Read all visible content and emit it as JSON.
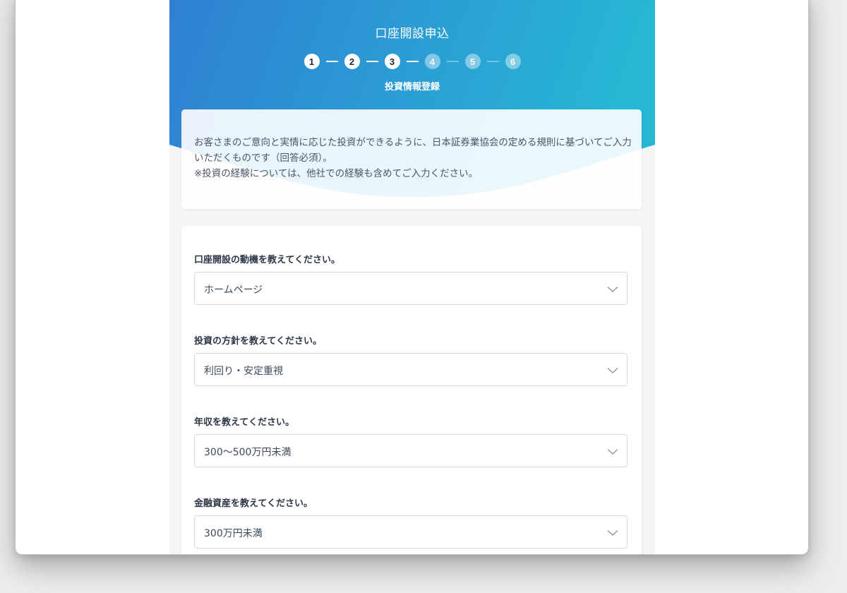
{
  "header": {
    "title": "口座開設申込",
    "steps": [
      "1",
      "2",
      "3",
      "4",
      "5",
      "6"
    ],
    "current_step": 3,
    "step_caption": "投資情報登録"
  },
  "notice": {
    "text": "お客さまのご意向と実情に応じた投資ができるように、日本証券業協会の定める規則に基づいてご入力いただくものです（回答必須）。\n※投資の経験については、他社での経験も含めてご入力ください。"
  },
  "form": {
    "fields": [
      {
        "label": "口座開設の動機を教えてください。",
        "value": "ホームページ"
      },
      {
        "label": "投資の方針を教えてください。",
        "value": "利回り・安定重視"
      },
      {
        "label": "年収を教えてください。",
        "value": "300〜500万円未満"
      },
      {
        "label": "金融資産を教えてください。",
        "value": "300万円未満"
      }
    ]
  },
  "colors": {
    "gradient_start": "#2f7fd3",
    "gradient_end": "#27b7d4",
    "page_background": "#f5f5f6"
  },
  "icons": {
    "select_arrow": "chevron-down-icon"
  }
}
